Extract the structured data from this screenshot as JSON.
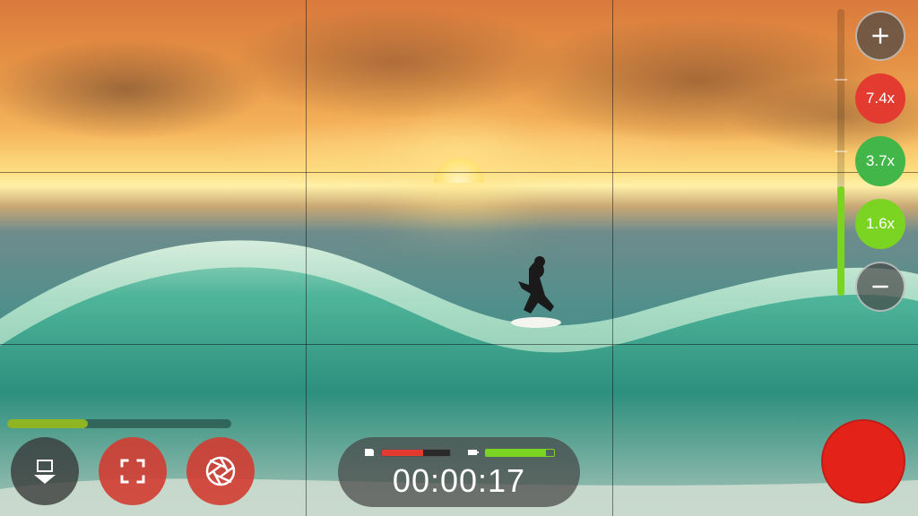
{
  "timer": {
    "elapsed": "00:00:17"
  },
  "zoom": {
    "plus_label": "+",
    "minus_label": "−",
    "presets": [
      "7.4x",
      "3.7x",
      "1.6x"
    ],
    "preset_colors": [
      "#e33b2f",
      "#43b64a",
      "#7bd421"
    ],
    "track_fill_percent": 38
  },
  "exposure": {
    "fill_percent": 36
  },
  "levels": {
    "storage_percent": 60,
    "battery_percent": 88
  },
  "colors": {
    "green": "#7bd421",
    "red": "#e33b2f",
    "record": "#e3231a"
  },
  "buttons": {
    "gallery": "gallery",
    "focus_frame": "focus-frame",
    "aperture": "aperture",
    "record": "record"
  }
}
